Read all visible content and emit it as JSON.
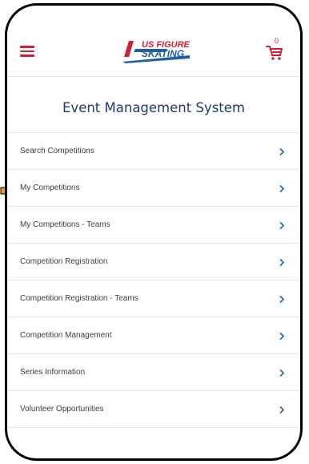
{
  "header": {
    "menu_icon": "hamburger-menu-icon",
    "logo_line1": "US FIGURE",
    "logo_line2": "SKATING",
    "cart_icon": "shopping-cart-icon",
    "cart_count": "0"
  },
  "page": {
    "title": "Event Management System"
  },
  "menu": {
    "items": [
      {
        "label": "Search Competitions"
      },
      {
        "label": "My Competitions"
      },
      {
        "label": "My Competitions - Teams"
      },
      {
        "label": "Competition Registration"
      },
      {
        "label": "Competition Registration - Teams"
      },
      {
        "label": "Competition Management"
      },
      {
        "label": "Series Information"
      },
      {
        "label": "Volunteer Opportunities"
      }
    ],
    "chevron_icon": "chevron-right-icon"
  },
  "colors": {
    "brand_red": "#d11f36",
    "brand_blue": "#1f5fa6",
    "title_navy": "#1f3a73",
    "chevron_blue": "#2b6cb0",
    "pointer_orange": "#e8a317"
  }
}
